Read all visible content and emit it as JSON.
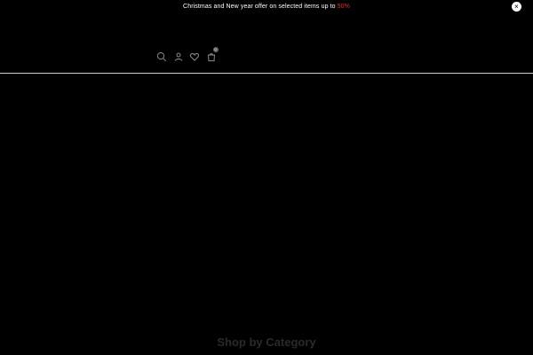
{
  "announcement": {
    "text": "Christmas and New year offer on selected items up to",
    "highlight": "50%",
    "highlight_color": "#e0322e",
    "close_symbol": "×"
  },
  "header": {
    "icons": [
      "search-icon",
      "account-icon",
      "wishlist-icon",
      "cart-icon"
    ],
    "cart_count": "0"
  },
  "main": {
    "section_title": "Shop by Category"
  }
}
